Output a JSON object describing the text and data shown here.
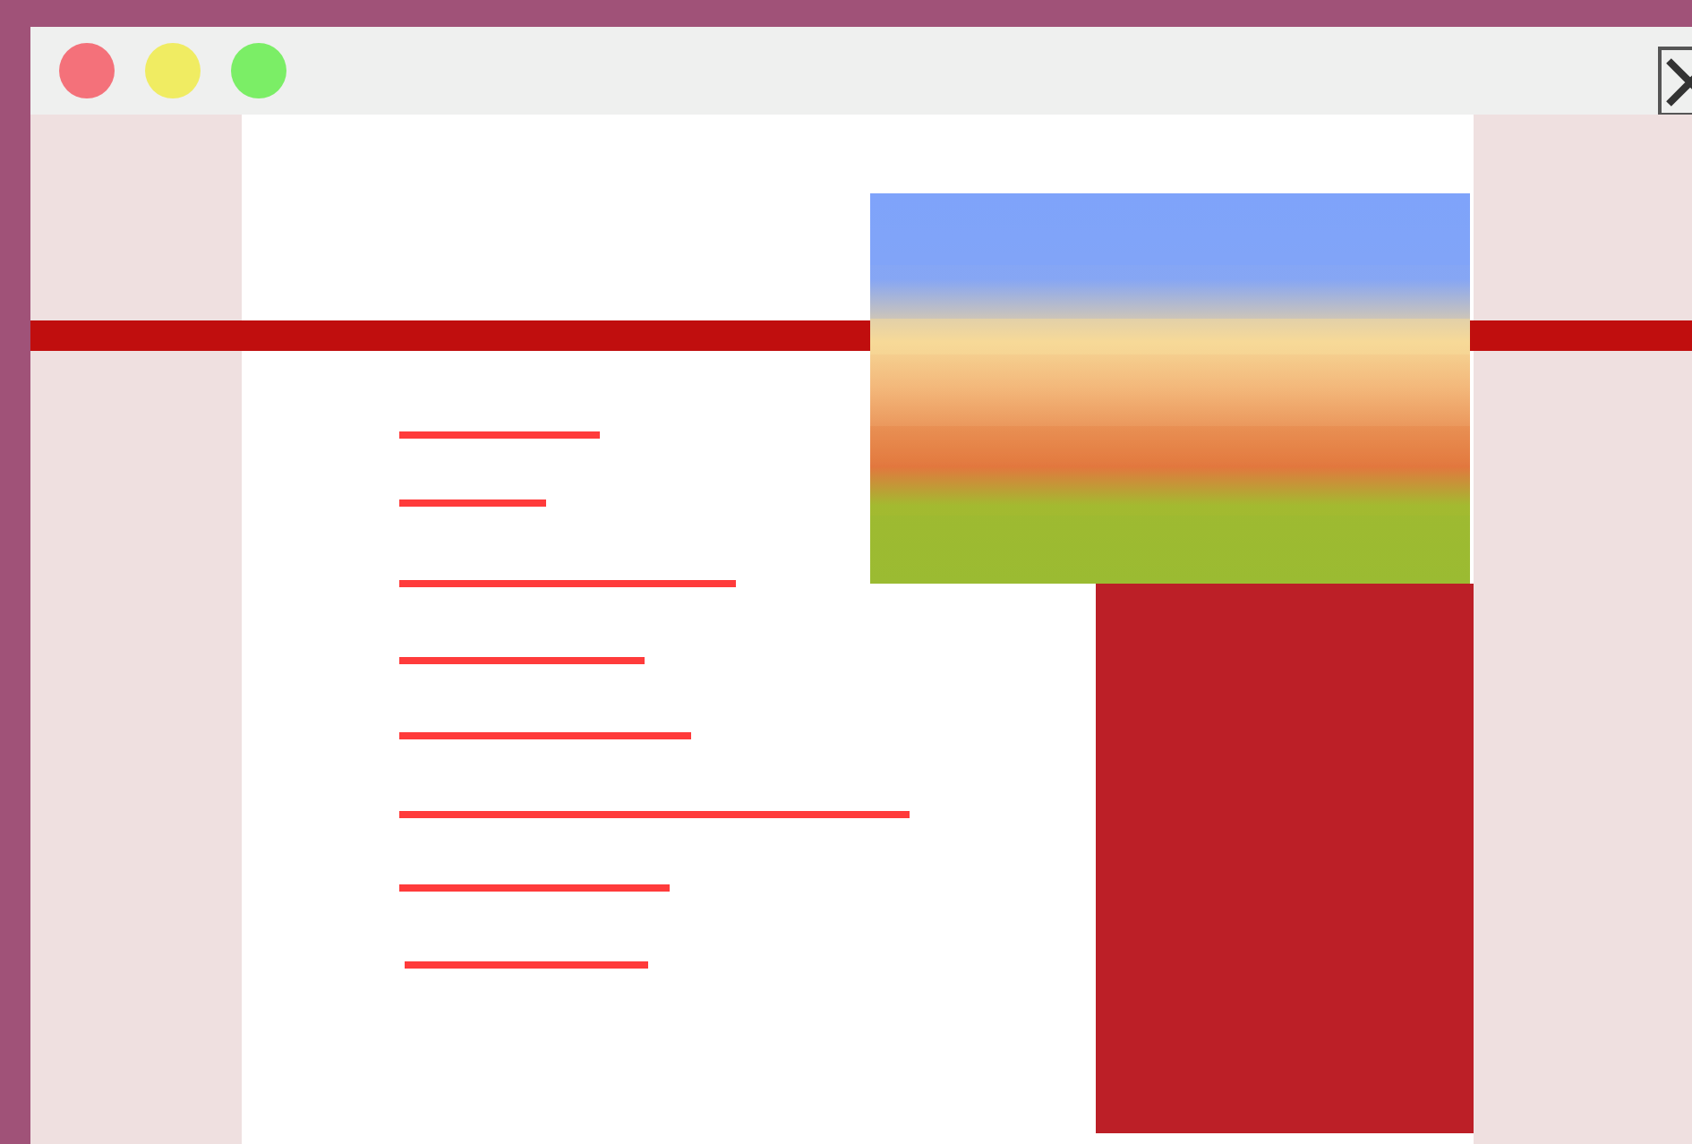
{
  "window": {
    "controls": [
      {
        "color": "#f4717a"
      },
      {
        "color": "#f0ec62"
      },
      {
        "color": "#7bee66"
      }
    ],
    "close_button": {
      "kind": "x"
    }
  },
  "header_band": {
    "kind": "bar"
  },
  "content": {
    "lines": [
      {
        "kind": "line"
      },
      {
        "kind": "line"
      },
      {
        "kind": "line"
      },
      {
        "kind": "line"
      },
      {
        "kind": "line"
      },
      {
        "kind": "line"
      },
      {
        "kind": "line"
      },
      {
        "kind": "line"
      }
    ],
    "side_block": {
      "kind": "block"
    }
  }
}
